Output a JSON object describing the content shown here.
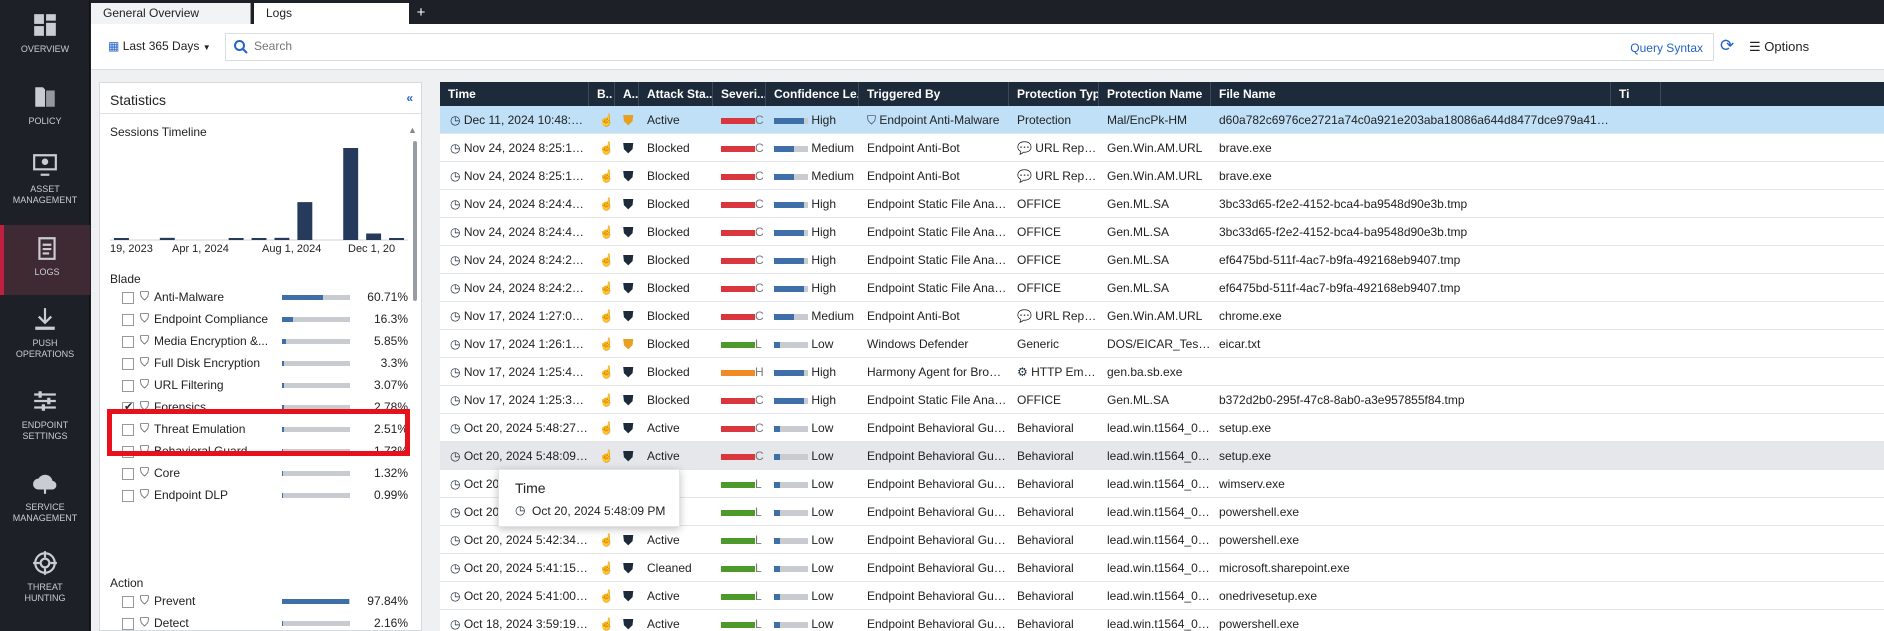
{
  "nav": {
    "items": [
      {
        "label": "OVERVIEW",
        "icon": "overview-icon"
      },
      {
        "label": "POLICY",
        "icon": "policy-icon"
      },
      {
        "label": "ASSET\nMANAGEMENT",
        "icon": "asset-icon"
      },
      {
        "label": "LOGS",
        "icon": "logs-icon"
      },
      {
        "label": "PUSH\nOPERATIONS",
        "icon": "push-icon"
      },
      {
        "label": "ENDPOINT\nSETTINGS",
        "icon": "settings-icon"
      },
      {
        "label": "SERVICE\nMANAGEMENT",
        "icon": "service-icon"
      },
      {
        "label": "THREAT\nHUNTING",
        "icon": "threat-icon"
      }
    ]
  },
  "tabs": [
    {
      "label": "General Overview"
    },
    {
      "label": "Logs"
    },
    {
      "label": "+"
    }
  ],
  "toolbar": {
    "range": "Last 365 Days",
    "search_placeholder": "Search",
    "query_syntax": "Query Syntax",
    "options": "Options"
  },
  "stats": {
    "title": "Statistics",
    "timeline_title": "Sessions Timeline",
    "timeline_ticks": [
      "19, 2023",
      "Apr 1, 2024",
      "Aug 1, 2024",
      "Dec 1, 20"
    ],
    "timeline_values": [
      0.5,
      0,
      2,
      0,
      0,
      1,
      1,
      2,
      35,
      0,
      85,
      6,
      1
    ],
    "blade_title": "Blade",
    "blade": [
      {
        "label": "Anti-Malware",
        "pct": "60.71%",
        "value": 60.71,
        "checked": false
      },
      {
        "label": "Endpoint Compliance",
        "pct": "16.3%",
        "value": 16.3,
        "checked": false
      },
      {
        "label": "Media Encryption &...",
        "pct": "5.85%",
        "value": 5.85,
        "checked": false
      },
      {
        "label": "Full Disk Encryption",
        "pct": "3.3%",
        "value": 3.3,
        "checked": false
      },
      {
        "label": "URL Filtering",
        "pct": "3.07%",
        "value": 3.07,
        "checked": false
      },
      {
        "label": "Forensics",
        "pct": "2.78%",
        "value": 2.78,
        "checked": true
      },
      {
        "label": "Threat Emulation",
        "pct": "2.51%",
        "value": 2.51,
        "checked": false
      },
      {
        "label": "Behavioral Guard",
        "pct": "1.73%",
        "value": 1.73,
        "checked": false
      },
      {
        "label": "Core",
        "pct": "1.32%",
        "value": 1.32,
        "checked": false
      },
      {
        "label": "Endpoint DLP",
        "pct": "0.99%",
        "value": 0.99,
        "checked": false
      }
    ],
    "action_title": "Action",
    "action": [
      {
        "label": "Prevent",
        "pct": "97.84%",
        "value": 97.84
      },
      {
        "label": "Detect",
        "pct": "2.16%",
        "value": 2.16
      }
    ]
  },
  "columns": [
    "Time",
    "B..",
    "A..",
    "Attack Sta...",
    "Severi...",
    "Confidence Le...",
    "Triggered By",
    "Protection Type",
    "Protection Name",
    "File Name",
    "Ti"
  ],
  "rows": [
    {
      "time": "Dec 11, 2024 10:48:09 ...",
      "status": "Active",
      "sev": "C",
      "sevc": "#d9363e",
      "conf": "High",
      "trig": "Endpoint Anti-Malware",
      "ptype": "Protection",
      "pname": "Mal/EncPk-HM",
      "file": "d60a782c6976ce2721a74c0a921e203aba18086a644d8477dce979a41863a331.e...",
      "sel": true,
      "act": "#e8a020"
    },
    {
      "time": "Nov 24, 2024 8:25:18 PM",
      "status": "Blocked",
      "sev": "C",
      "sevc": "#d9363e",
      "conf": "Medium",
      "trig": "Endpoint Anti-Bot",
      "ptype": "URL Reput...",
      "pname": "Gen.Win.AM.URL",
      "file": "brave.exe"
    },
    {
      "time": "Nov 24, 2024 8:25:18 PM",
      "status": "Blocked",
      "sev": "C",
      "sevc": "#d9363e",
      "conf": "Medium",
      "trig": "Endpoint Anti-Bot",
      "ptype": "URL Reput...",
      "pname": "Gen.Win.AM.URL",
      "file": "brave.exe"
    },
    {
      "time": "Nov 24, 2024 8:24:45 PM",
      "status": "Blocked",
      "sev": "C",
      "sevc": "#d9363e",
      "conf": "High",
      "trig": "Endpoint Static File Analysis",
      "ptype": "OFFICE",
      "pname": "Gen.ML.SA",
      "file": "3bc33d65-f2e2-4152-bca4-ba9548d90e3b.tmp"
    },
    {
      "time": "Nov 24, 2024 8:24:45 PM",
      "status": "Blocked",
      "sev": "C",
      "sevc": "#d9363e",
      "conf": "High",
      "trig": "Endpoint Static File Analysis",
      "ptype": "OFFICE",
      "pname": "Gen.ML.SA",
      "file": "3bc33d65-f2e2-4152-bca4-ba9548d90e3b.tmp"
    },
    {
      "time": "Nov 24, 2024 8:24:29 PM",
      "status": "Blocked",
      "sev": "C",
      "sevc": "#d9363e",
      "conf": "High",
      "trig": "Endpoint Static File Analysis",
      "ptype": "OFFICE",
      "pname": "Gen.ML.SA",
      "file": "ef6475bd-511f-4ac7-b9fa-492168eb9407.tmp"
    },
    {
      "time": "Nov 24, 2024 8:24:29 PM",
      "status": "Blocked",
      "sev": "C",
      "sevc": "#d9363e",
      "conf": "High",
      "trig": "Endpoint Static File Analysis",
      "ptype": "OFFICE",
      "pname": "Gen.ML.SA",
      "file": "ef6475bd-511f-4ac7-b9fa-492168eb9407.tmp"
    },
    {
      "time": "Nov 17, 2024 1:27:00 PM",
      "status": "Blocked",
      "sev": "C",
      "sevc": "#d9363e",
      "conf": "Medium",
      "trig": "Endpoint Anti-Bot",
      "ptype": "URL Reput...",
      "pname": "Gen.Win.AM.URL",
      "file": "chrome.exe"
    },
    {
      "time": "Nov 17, 2024 1:26:19 PM",
      "status": "Blocked",
      "sev": "L",
      "sevc": "#4c9a2a",
      "conf": "Low",
      "trig": "Windows Defender",
      "ptype": "Generic",
      "pname": "DOS/EICAR_Test_File",
      "file": "eicar.txt",
      "act": "#e8a020"
    },
    {
      "time": "Nov 17, 2024 1:25:46 PM",
      "status": "Blocked",
      "sev": "H",
      "sevc": "#f08a24",
      "conf": "High",
      "trig": "Harmony Agent for Browse...",
      "ptype": "HTTP Emu...",
      "pname": "gen.ba.sb.exe",
      "file": ""
    },
    {
      "time": "Nov 17, 2024 1:25:32 PM",
      "status": "Blocked",
      "sev": "C",
      "sevc": "#d9363e",
      "conf": "High",
      "trig": "Endpoint Static File Analysis",
      "ptype": "OFFICE",
      "pname": "Gen.ML.SA",
      "file": "b372d2b0-295f-47c8-8ab0-a3e957855f84.tmp"
    },
    {
      "time": "Oct 20, 2024 5:48:27 PM",
      "status": "Active",
      "sev": "C",
      "sevc": "#d9363e",
      "conf": "Low",
      "trig": "Endpoint Behavioral Guard",
      "ptype": "Behavioral",
      "pname": "lead.win.t1564_003...",
      "file": "setup.exe"
    },
    {
      "time": "Oct 20, 2024 5:48:09 PM",
      "status": "Active",
      "sev": "C",
      "sevc": "#d9363e",
      "conf": "Low",
      "trig": "Endpoint Behavioral Guard",
      "ptype": "Behavioral",
      "pname": "lead.win.t1564_003...",
      "file": "setup.exe",
      "hover": true
    },
    {
      "time": "Oct 20, 2024 5:46:34 PM",
      "status": "Active",
      "sev": "L",
      "sevc": "#4c9a2a",
      "conf": "Low",
      "trig": "Endpoint Behavioral Guard",
      "ptype": "Behavioral",
      "pname": "lead.win.t1564_003...",
      "file": "wimserv.exe"
    },
    {
      "time": "Oct 20, 2024 5:43:02 PM",
      "status": "Active",
      "sev": "L",
      "sevc": "#4c9a2a",
      "conf": "Low",
      "trig": "Endpoint Behavioral Guard",
      "ptype": "Behavioral",
      "pname": "lead.win.t1564_003...",
      "file": "powershell.exe"
    },
    {
      "time": "Oct 20, 2024 5:42:34 PM",
      "status": "Active",
      "sev": "L",
      "sevc": "#4c9a2a",
      "conf": "Low",
      "trig": "Endpoint Behavioral Guard",
      "ptype": "Behavioral",
      "pname": "lead.win.t1564_003...",
      "file": "powershell.exe"
    },
    {
      "time": "Oct 20, 2024 5:41:15 PM",
      "status": "Cleaned",
      "sev": "L",
      "sevc": "#4c9a2a",
      "conf": "Low",
      "trig": "Endpoint Behavioral Guard",
      "ptype": "Behavioral",
      "pname": "lead.win.t1564_003...",
      "file": "microsoft.sharepoint.exe"
    },
    {
      "time": "Oct 20, 2024 5:41:00 PM",
      "status": "Active",
      "sev": "L",
      "sevc": "#4c9a2a",
      "conf": "Low",
      "trig": "Endpoint Behavioral Guard",
      "ptype": "Behavioral",
      "pname": "lead.win.t1564_003...",
      "file": "onedrivesetup.exe"
    },
    {
      "time": "Oct 18, 2024 3:59:19 AM",
      "status": "Active",
      "sev": "L",
      "sevc": "#4c9a2a",
      "conf": "Low",
      "trig": "Endpoint Behavioral Guard",
      "ptype": "Behavioral",
      "pname": "lead.win.t1564_003...",
      "file": "powershell.exe"
    }
  ],
  "tooltip": {
    "title": "Time",
    "value": "Oct 20, 2024 5:48:09 PM"
  },
  "colors": {
    "accent": "#2563c6",
    "highlight": "#e8101a",
    "selected_row": "#bfe0f7",
    "hover_row": "#e5e7ea",
    "header": "#1c2a3a"
  }
}
